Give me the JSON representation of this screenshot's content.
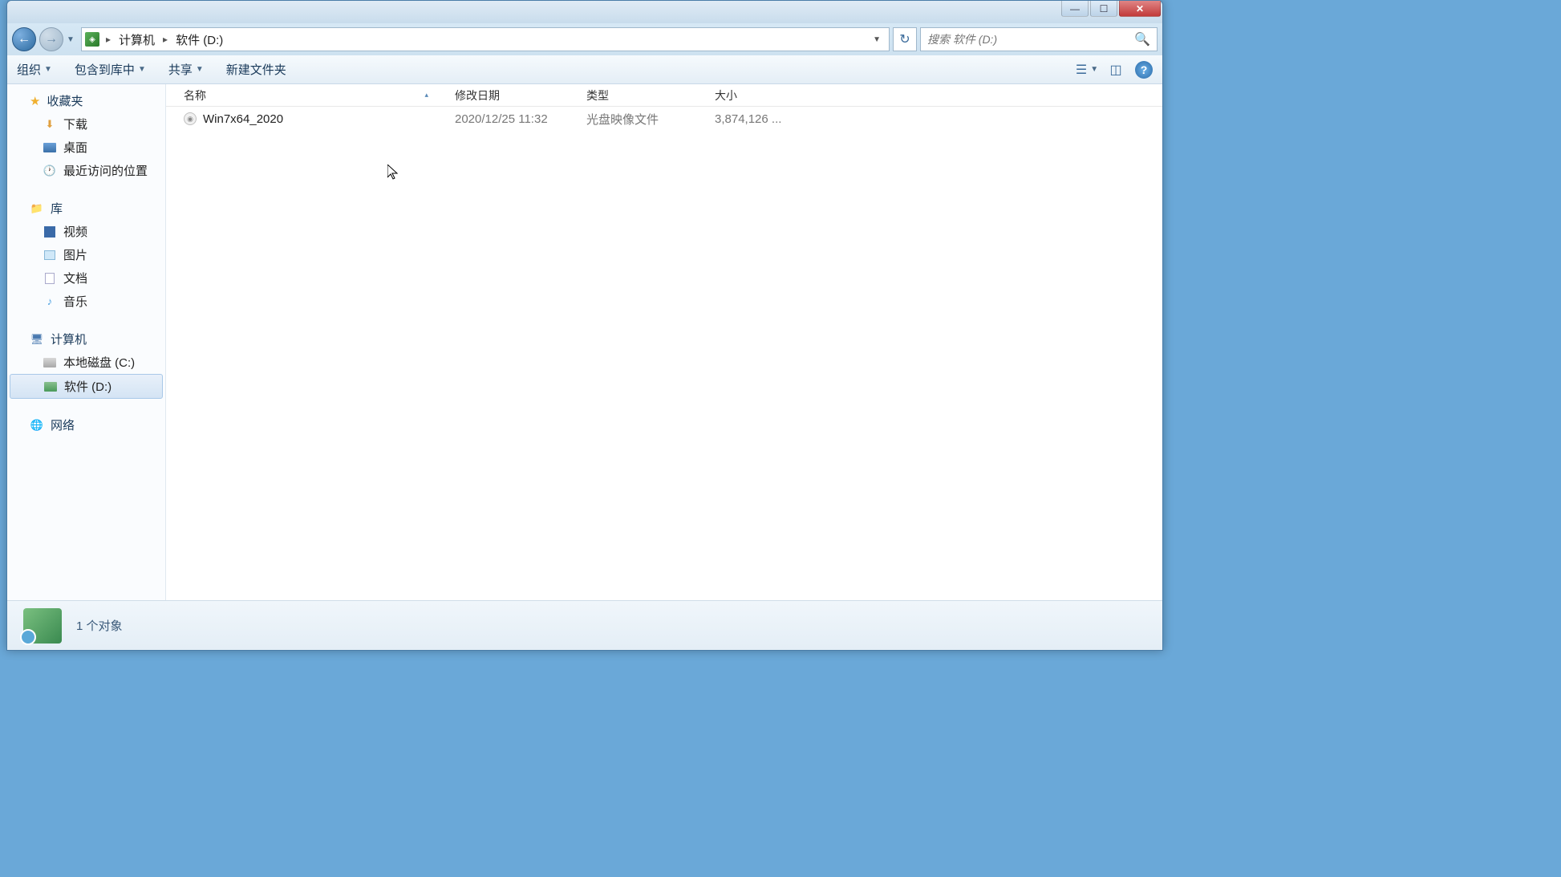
{
  "titlebar": {
    "minimize_glyph": "—",
    "maximize_glyph": "☐",
    "close_glyph": "✕"
  },
  "address": {
    "segments": [
      "计算机",
      "软件 (D:)"
    ]
  },
  "search": {
    "placeholder": "搜索 软件 (D:)"
  },
  "toolbar": {
    "organize": "组织",
    "include_in_library": "包含到库中",
    "share": "共享",
    "new_folder": "新建文件夹"
  },
  "sidebar": {
    "favorites": {
      "label": "收藏夹",
      "items": [
        {
          "label": "下载"
        },
        {
          "label": "桌面"
        },
        {
          "label": "最近访问的位置"
        }
      ]
    },
    "libraries": {
      "label": "库",
      "items": [
        {
          "label": "视频"
        },
        {
          "label": "图片"
        },
        {
          "label": "文档"
        },
        {
          "label": "音乐"
        }
      ]
    },
    "computer": {
      "label": "计算机",
      "items": [
        {
          "label": "本地磁盘 (C:)"
        },
        {
          "label": "软件 (D:)",
          "selected": true
        }
      ]
    },
    "network": {
      "label": "网络"
    }
  },
  "columns": {
    "name": "名称",
    "date": "修改日期",
    "type": "类型",
    "size": "大小"
  },
  "files": [
    {
      "name": "Win7x64_2020",
      "date": "2020/12/25 11:32",
      "type": "光盘映像文件",
      "size": "3,874,126 ..."
    }
  ],
  "statusbar": {
    "count_text": "1 个对象"
  }
}
